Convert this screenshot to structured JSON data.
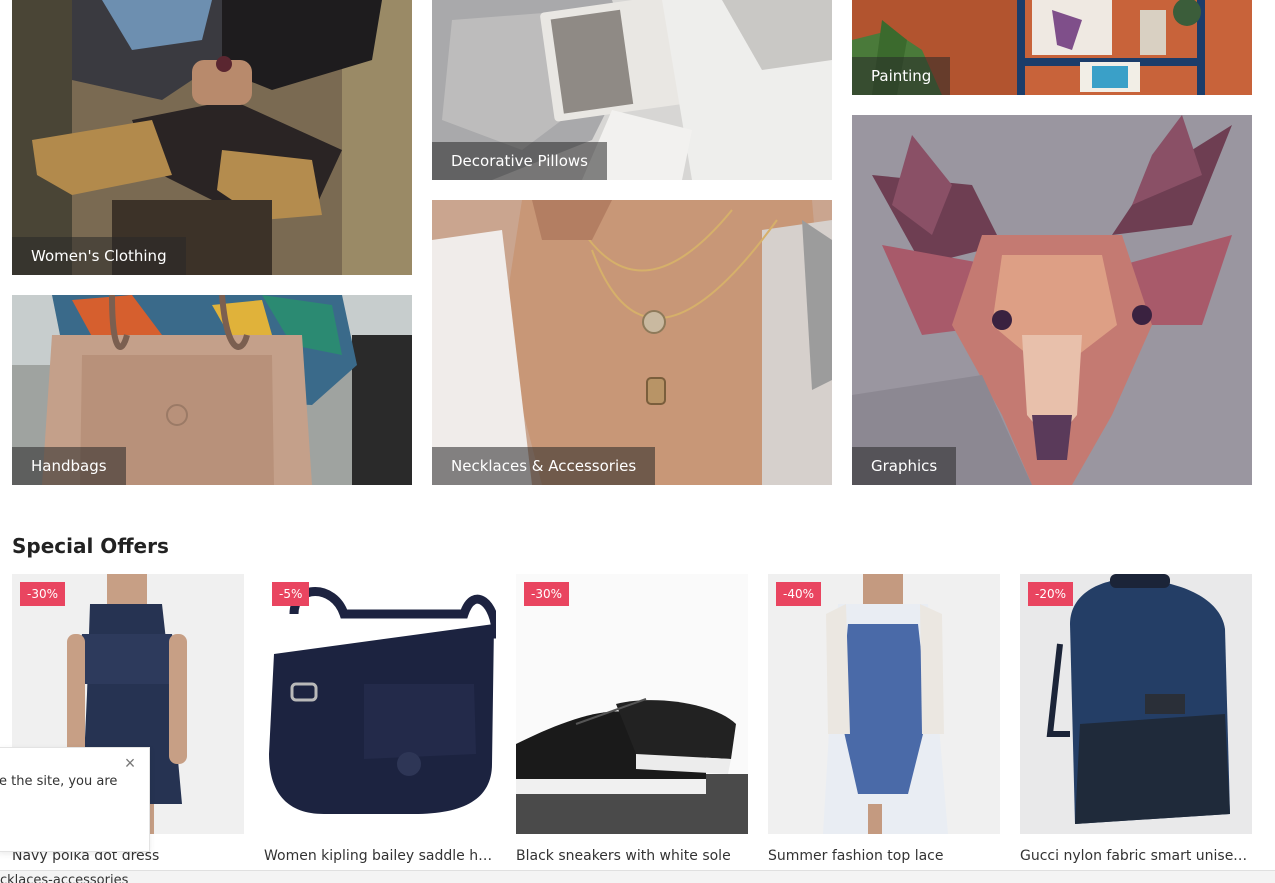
{
  "categories": [
    {
      "id": "womens-clothing",
      "label": "Women's Clothing"
    },
    {
      "id": "decorative-pillows",
      "label": "Decorative Pillows"
    },
    {
      "id": "painting",
      "label": "Painting"
    },
    {
      "id": "handbags",
      "label": "Handbags"
    },
    {
      "id": "necklaces-accessories",
      "label": "Necklaces & Accessories"
    },
    {
      "id": "graphics",
      "label": "Graphics"
    }
  ],
  "special_offers": {
    "title": "Special Offers",
    "products": [
      {
        "name": "Navy polka dot dress",
        "discount": "-30%"
      },
      {
        "name": "Women kipling bailey saddle ha...",
        "discount": "-5%"
      },
      {
        "name": "Black sneakers with white sole",
        "discount": "-30%"
      },
      {
        "name": "Summer fashion top lace",
        "discount": "-40%"
      },
      {
        "name": "Gucci nylon fabric smart unisex ...",
        "discount": "-20%"
      }
    ]
  },
  "cookie_notice": {
    "text": "e the site, you are",
    "close_icon": "close-icon"
  },
  "status_bar": {
    "url_text": "cklaces-accessories"
  },
  "colors": {
    "badge": "#e94560",
    "label_overlay": "rgba(40,40,40,0.55)"
  }
}
